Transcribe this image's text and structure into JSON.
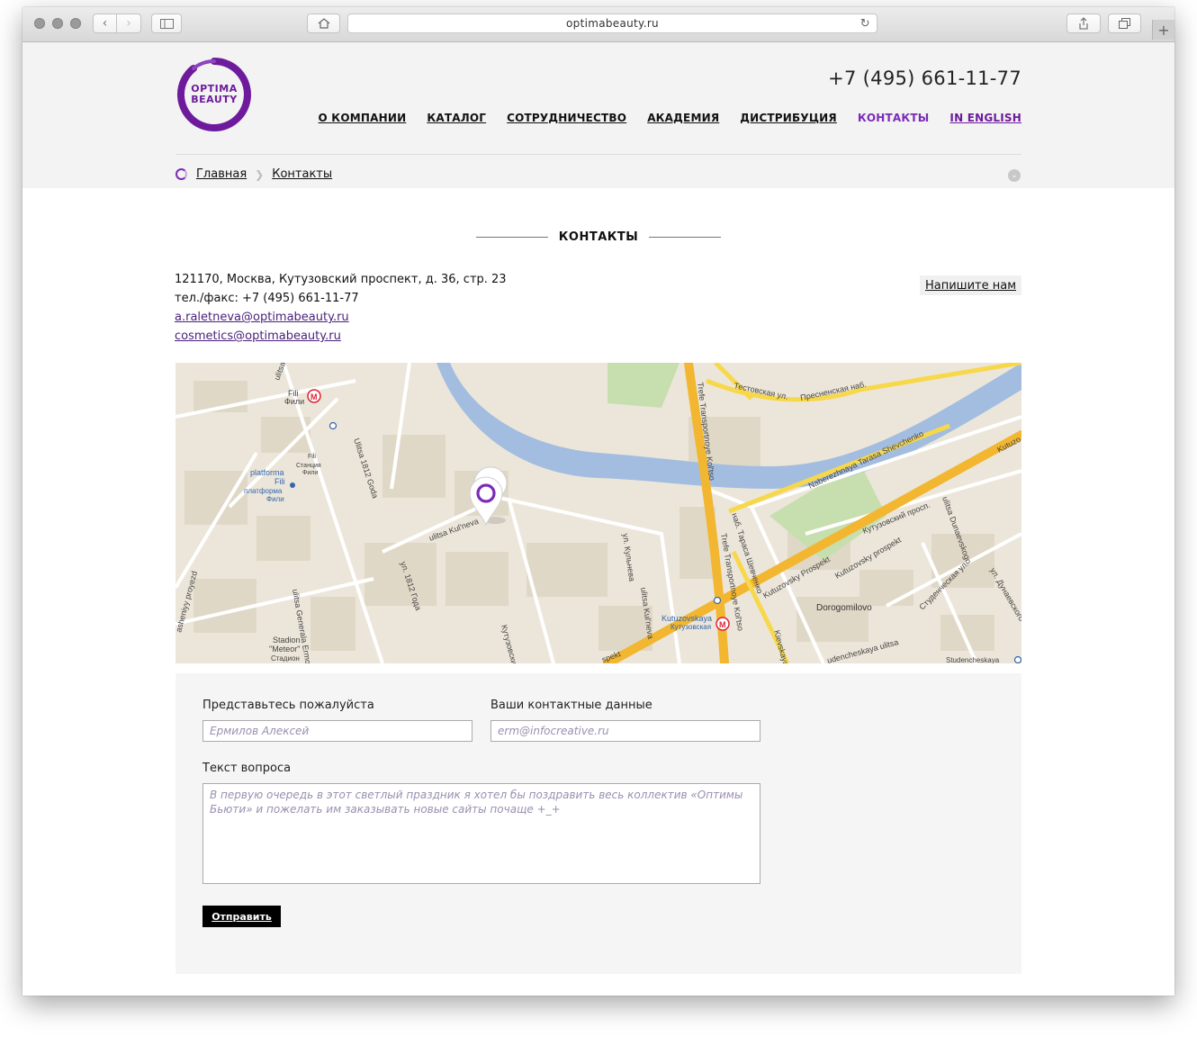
{
  "browser": {
    "url": "optimabeauty.ru"
  },
  "header": {
    "logo": {
      "line1": "OPTIMA",
      "line2": "BEAUTY"
    },
    "phone": "+7 (495) 661-11-77",
    "nav": [
      {
        "label": "О КОМПАНИИ"
      },
      {
        "label": "КАТАЛОГ"
      },
      {
        "label": "СОТРУДНИЧЕСТВО"
      },
      {
        "label": "АКАДЕМИЯ"
      },
      {
        "label": "ДИСТРИБУЦИЯ"
      },
      {
        "label": "КОНТАКТЫ",
        "active": true
      },
      {
        "label": "IN ENGLISH"
      }
    ]
  },
  "breadcrumb": {
    "home": "Главная",
    "current": "Контакты"
  },
  "page": {
    "title": "КОНТАКТЫ",
    "address": "121170, Москва, Кутузовский проспект, д. 36, стр. 23",
    "phone_fax": "тел./факс: +7 (495) 661-11-77",
    "emails": [
      "a.raletneva@optimabeauty.ru",
      "cosmetics@optimabeauty.ru"
    ],
    "write_us": "Напишите нам"
  },
  "map": {
    "labels": {
      "fili": "Fili",
      "fili_ru": "Фили",
      "fili_station": "Fili",
      "station_ru": "Станция",
      "fili_ru2": "Фили",
      "platforma": "platforma",
      "platforma_fili": "Fili",
      "platforma_ru": "платформа",
      "fili_ru3": "Фили",
      "ulitsa_top": "ulitsa",
      "ulitsa_1812": "Ulitsa 1812 Goda",
      "ul_1812": "ул. 1812 Года",
      "kulneva": "ulitsa Kul'neva",
      "kulneva_ru": "ул. Кульнева",
      "kulneva_ru2": "ulitsa Kul'neva",
      "kutuzovsky_lower": "Кутузовский",
      "proyezd": "asheniyy proyezd",
      "generala": "ulitsa Generala Ermolova",
      "stadion": "Stadion",
      "meteor": "\"Meteor\"",
      "stadion_ru": "Стадион",
      "ttk_top": "Trefe Transportnoye Kol'tso",
      "ttk_low": "Trefe Transportnoye Kol'tso",
      "testovskaya": "Тестовская ул.",
      "presnenskaya": "Пресненская наб.",
      "nab_shevchenko": "Naberezhnaya Tarasa Shevchenko",
      "nab_shevchenko_ru": "наб. Тараса Шевченко",
      "kutuz_prosp": "Kutuzovsky Prospekt",
      "kutuz_prosp2": "Kutuzovsky prospekt",
      "kutuz_prosp_ru": "Кутузовский просп.",
      "kutuz_top_right": "Kutuzo",
      "dunaevskogo": "ulitsa Dunaevskogo",
      "studencheskaya_ru": "Студенческая ул.",
      "ul_dunaev": "ул. Дунаевского",
      "dorogomilovo": "Dorogomilovo",
      "kutuzovskaya": "Kutuzovskaya",
      "kutuzovskaya_ru": "Кутузовская",
      "kievskaya": "Kievskaya",
      "studencheskaya": "Studencheskaya",
      "studencheskaya_ul": "udencheskaya ulitsa",
      "prospekt_left": "spekt"
    }
  },
  "form": {
    "name_label": "Представьтесь пожалуйста",
    "name_placeholder": "Ермилов Алексей",
    "contact_label": "Ваши контактные данные",
    "contact_placeholder": "erm@infocreative.ru",
    "question_label": "Текст вопроса",
    "question_placeholder": "В первую очередь в этот светлый праздник я хотел бы поздравить весь коллектив «Оптимы Бьюти» и пожелать им заказывать новые сайты почаще +_+",
    "submit": "Отправить"
  },
  "colors": {
    "brand_purple": "#6d1b9c",
    "nav_active": "#7a2bb8",
    "header_bg": "#f3f3f3",
    "form_bg": "#f5f5f5",
    "river": "#a3bde0",
    "road_yellow": "#f7c62f",
    "park_green": "#c7dfae"
  }
}
